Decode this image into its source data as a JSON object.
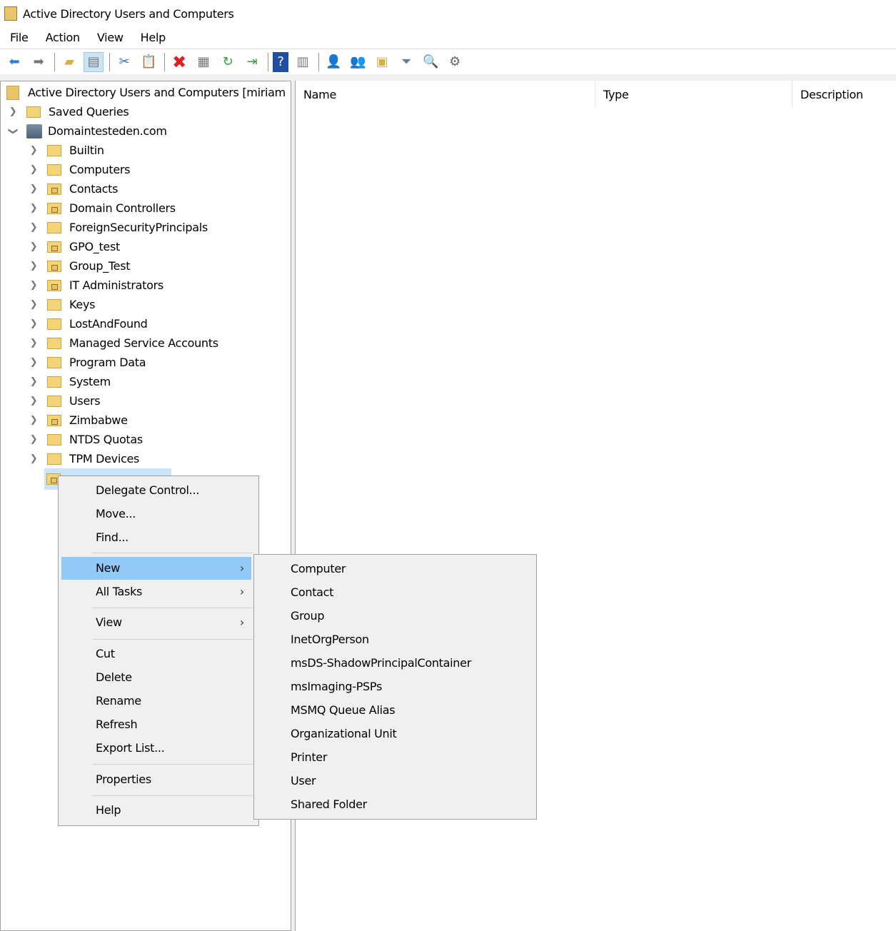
{
  "window": {
    "title": "Active Directory Users and Computers"
  },
  "menubar": [
    "File",
    "Action",
    "View",
    "Help"
  ],
  "toolbar": [
    "back-icon",
    "forward-icon",
    "up-folder-icon",
    "show-hide-console-tree-icon",
    "cut-icon",
    "paste-icon",
    "delete-icon",
    "properties-icon",
    "refresh-icon",
    "export-list-icon",
    "help-icon",
    "show-action-pane-icon",
    "new-user-icon",
    "new-group-icon",
    "new-ou-icon",
    "filter-icon",
    "find-icon",
    "delegate-icon"
  ],
  "tree": {
    "root": "Active Directory Users and Computers [miriam",
    "saved_queries": "Saved Queries",
    "domain": "Domaintesteden.com",
    "children": [
      {
        "label": "Builtin",
        "ou": false
      },
      {
        "label": "Computers",
        "ou": false
      },
      {
        "label": "Contacts",
        "ou": true
      },
      {
        "label": "Domain Controllers",
        "ou": true
      },
      {
        "label": "ForeignSecurityPrincipals",
        "ou": false
      },
      {
        "label": "GPO_test",
        "ou": true
      },
      {
        "label": "Group_Test",
        "ou": true
      },
      {
        "label": "IT Administrators",
        "ou": true
      },
      {
        "label": "Keys",
        "ou": false
      },
      {
        "label": "LostAndFound",
        "ou": false
      },
      {
        "label": "Managed Service Accounts",
        "ou": false
      },
      {
        "label": "Program Data",
        "ou": false
      },
      {
        "label": "System",
        "ou": false
      },
      {
        "label": "Users",
        "ou": false
      },
      {
        "label": "Zimbabwe",
        "ou": true
      },
      {
        "label": "NTDS Quotas",
        "ou": false
      },
      {
        "label": "TPM Devices",
        "ou": false
      }
    ]
  },
  "list": {
    "columns": [
      "Name",
      "Type",
      "Description"
    ]
  },
  "context_menu": {
    "items": [
      "Delegate Control...",
      "Move...",
      "Find...",
      "New",
      "All Tasks",
      "View",
      "Cut",
      "Delete",
      "Rename",
      "Refresh",
      "Export List...",
      "Properties",
      "Help"
    ],
    "highlighted": "New"
  },
  "submenu": {
    "items": [
      "Computer",
      "Contact",
      "Group",
      "InetOrgPerson",
      "msDS-ShadowPrincipalContainer",
      "msImaging-PSPs",
      "MSMQ Queue Alias",
      "Organizational Unit",
      "Printer",
      "User",
      "Shared Folder"
    ]
  },
  "colors": {
    "highlight": "#91c9f7",
    "selection": "#cce4f7",
    "menu_bg": "#f0f0f0"
  }
}
